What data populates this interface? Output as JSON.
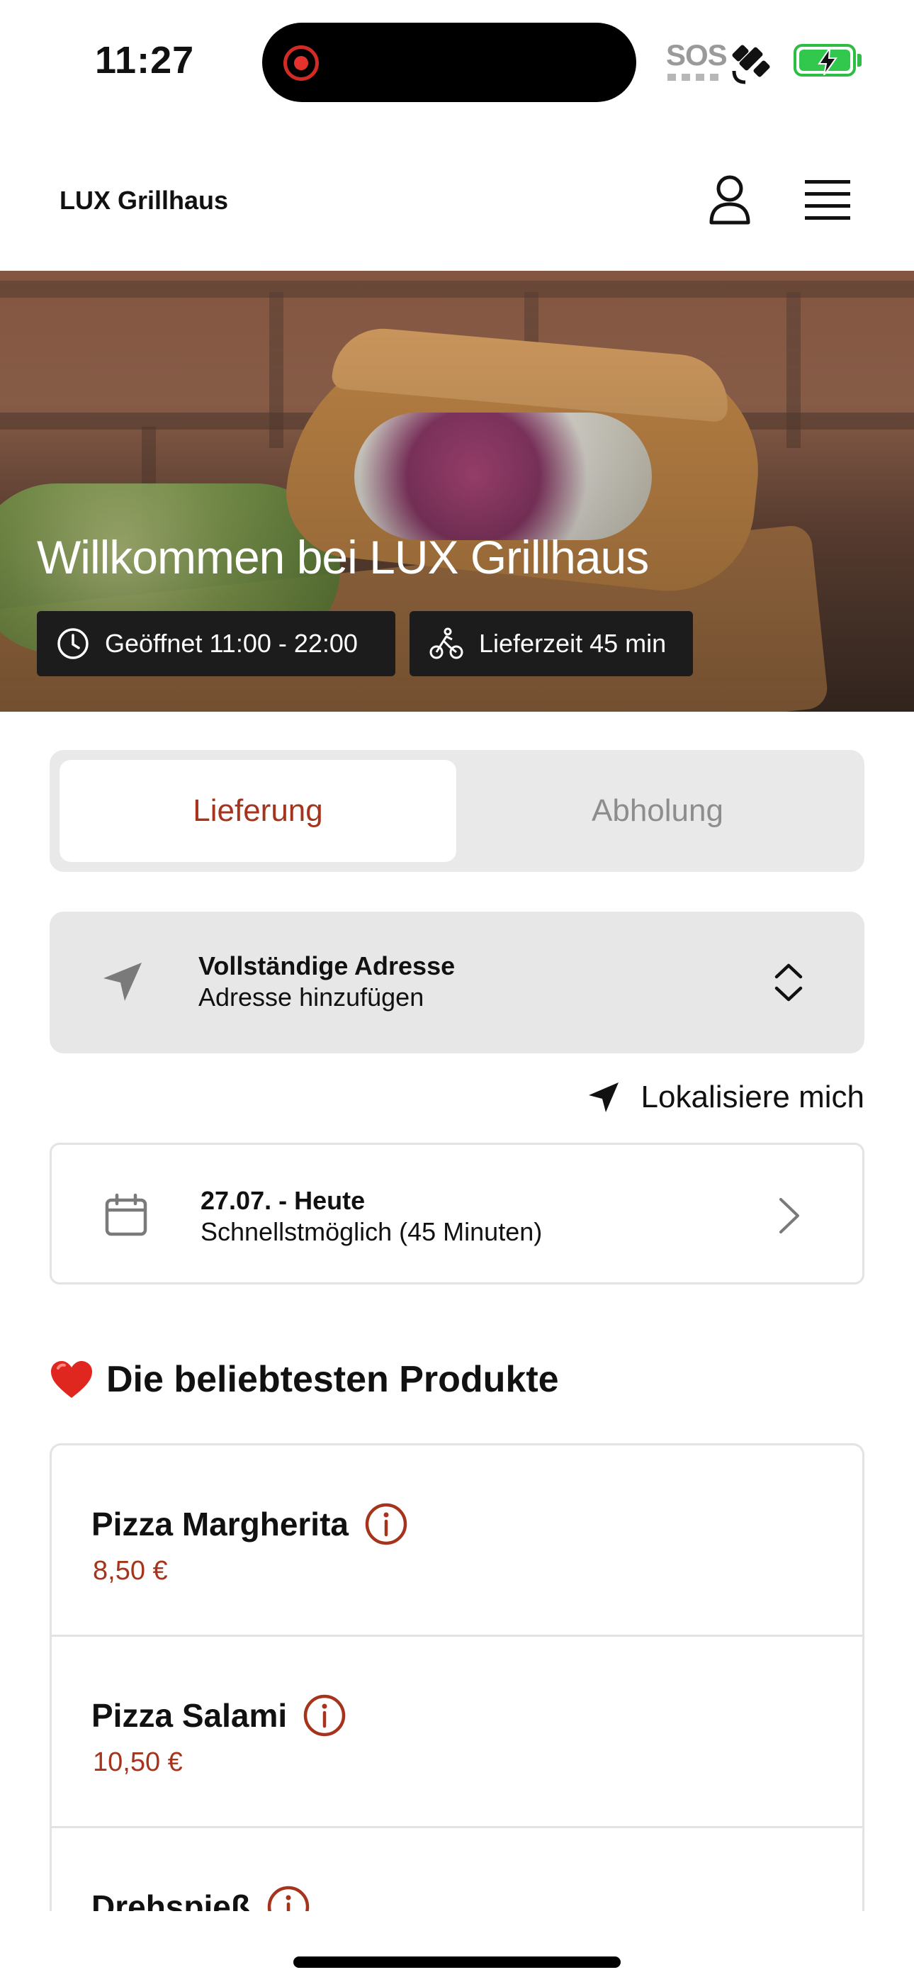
{
  "status_bar": {
    "time": "11:27",
    "sos": "SOS"
  },
  "header": {
    "brand": "LUX Grillhaus",
    "icons": [
      "user-icon",
      "menu-icon"
    ]
  },
  "hero": {
    "title": "Willkommen bei LUX Grillhaus",
    "open_hours": "Geöffnet 11:00 - 22:00",
    "delivery_time": "Lieferzeit 45 min"
  },
  "mode_toggle": {
    "delivery": "Lieferung",
    "pickup": "Abholung",
    "selected": "Lieferung"
  },
  "address": {
    "title": "Vollständige Adresse",
    "subtitle": "Adresse hinzufügen"
  },
  "locate": {
    "label": "Lokalisiere mich"
  },
  "schedule": {
    "title": "27.07. - Heute",
    "subtitle": "Schnellstmöglich (45 Minuten)"
  },
  "popular": {
    "title": "Die beliebtesten Produkte",
    "products": [
      {
        "name": "Pizza Margherita",
        "price": "8,50 €"
      },
      {
        "name": "Pizza Salami",
        "price": "10,50 €"
      },
      {
        "name": "Drehspieß",
        "price": ""
      }
    ]
  },
  "colors": {
    "accent": "#a6341d",
    "muted_bg": "#e8e8e8",
    "chip_bg": "#1c1c1c"
  }
}
